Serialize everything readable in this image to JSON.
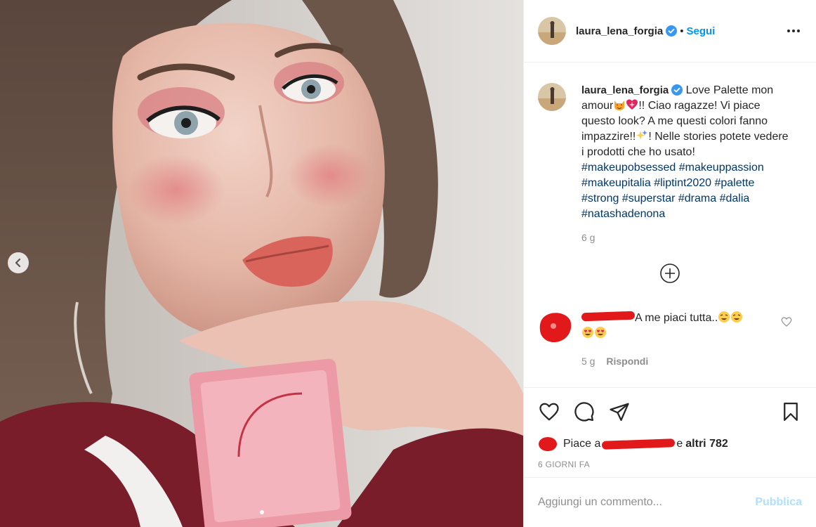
{
  "post": {
    "username": "laura_lena_forgia",
    "separator": "•",
    "follow_label": "Segui",
    "more_icon": "more-options-icon",
    "verified_color": "#3897f0",
    "caption": {
      "username": "laura_lena_forgia",
      "part1": "Love Palette mon amour",
      "part2": "!! Ciao ragazze! Vi piace questo look? A me questi colori fanno impazzire!!",
      "part3": "! Nelle stories potete vedere i prodotti che ho usato!",
      "hashtags": [
        "#makeupobsessed",
        "#makeuppassion",
        "#makeupitalia",
        "#liptint2020",
        "#palette",
        "#strong",
        "#superstar",
        "#drama",
        "#dalia",
        "#natashadenona"
      ]
    },
    "caption_time": "6 g",
    "comment": {
      "text": "A me piaci tutta..",
      "time": "5 g",
      "reply_label": "Rispondi"
    },
    "likes": {
      "prefix": "Piace a",
      "middle": "e",
      "suffix": "altri 782"
    },
    "date": "6 GIORNI FA",
    "comment_input": {
      "placeholder": "Aggiungi un commento...",
      "publish_label": "Pubblica"
    },
    "colors": {
      "link": "#0095f6",
      "hashtag": "#00376b",
      "muted": "#8e8e8e",
      "redaction": "#e2191b",
      "publish_disabled": "#b2dffc"
    }
  }
}
